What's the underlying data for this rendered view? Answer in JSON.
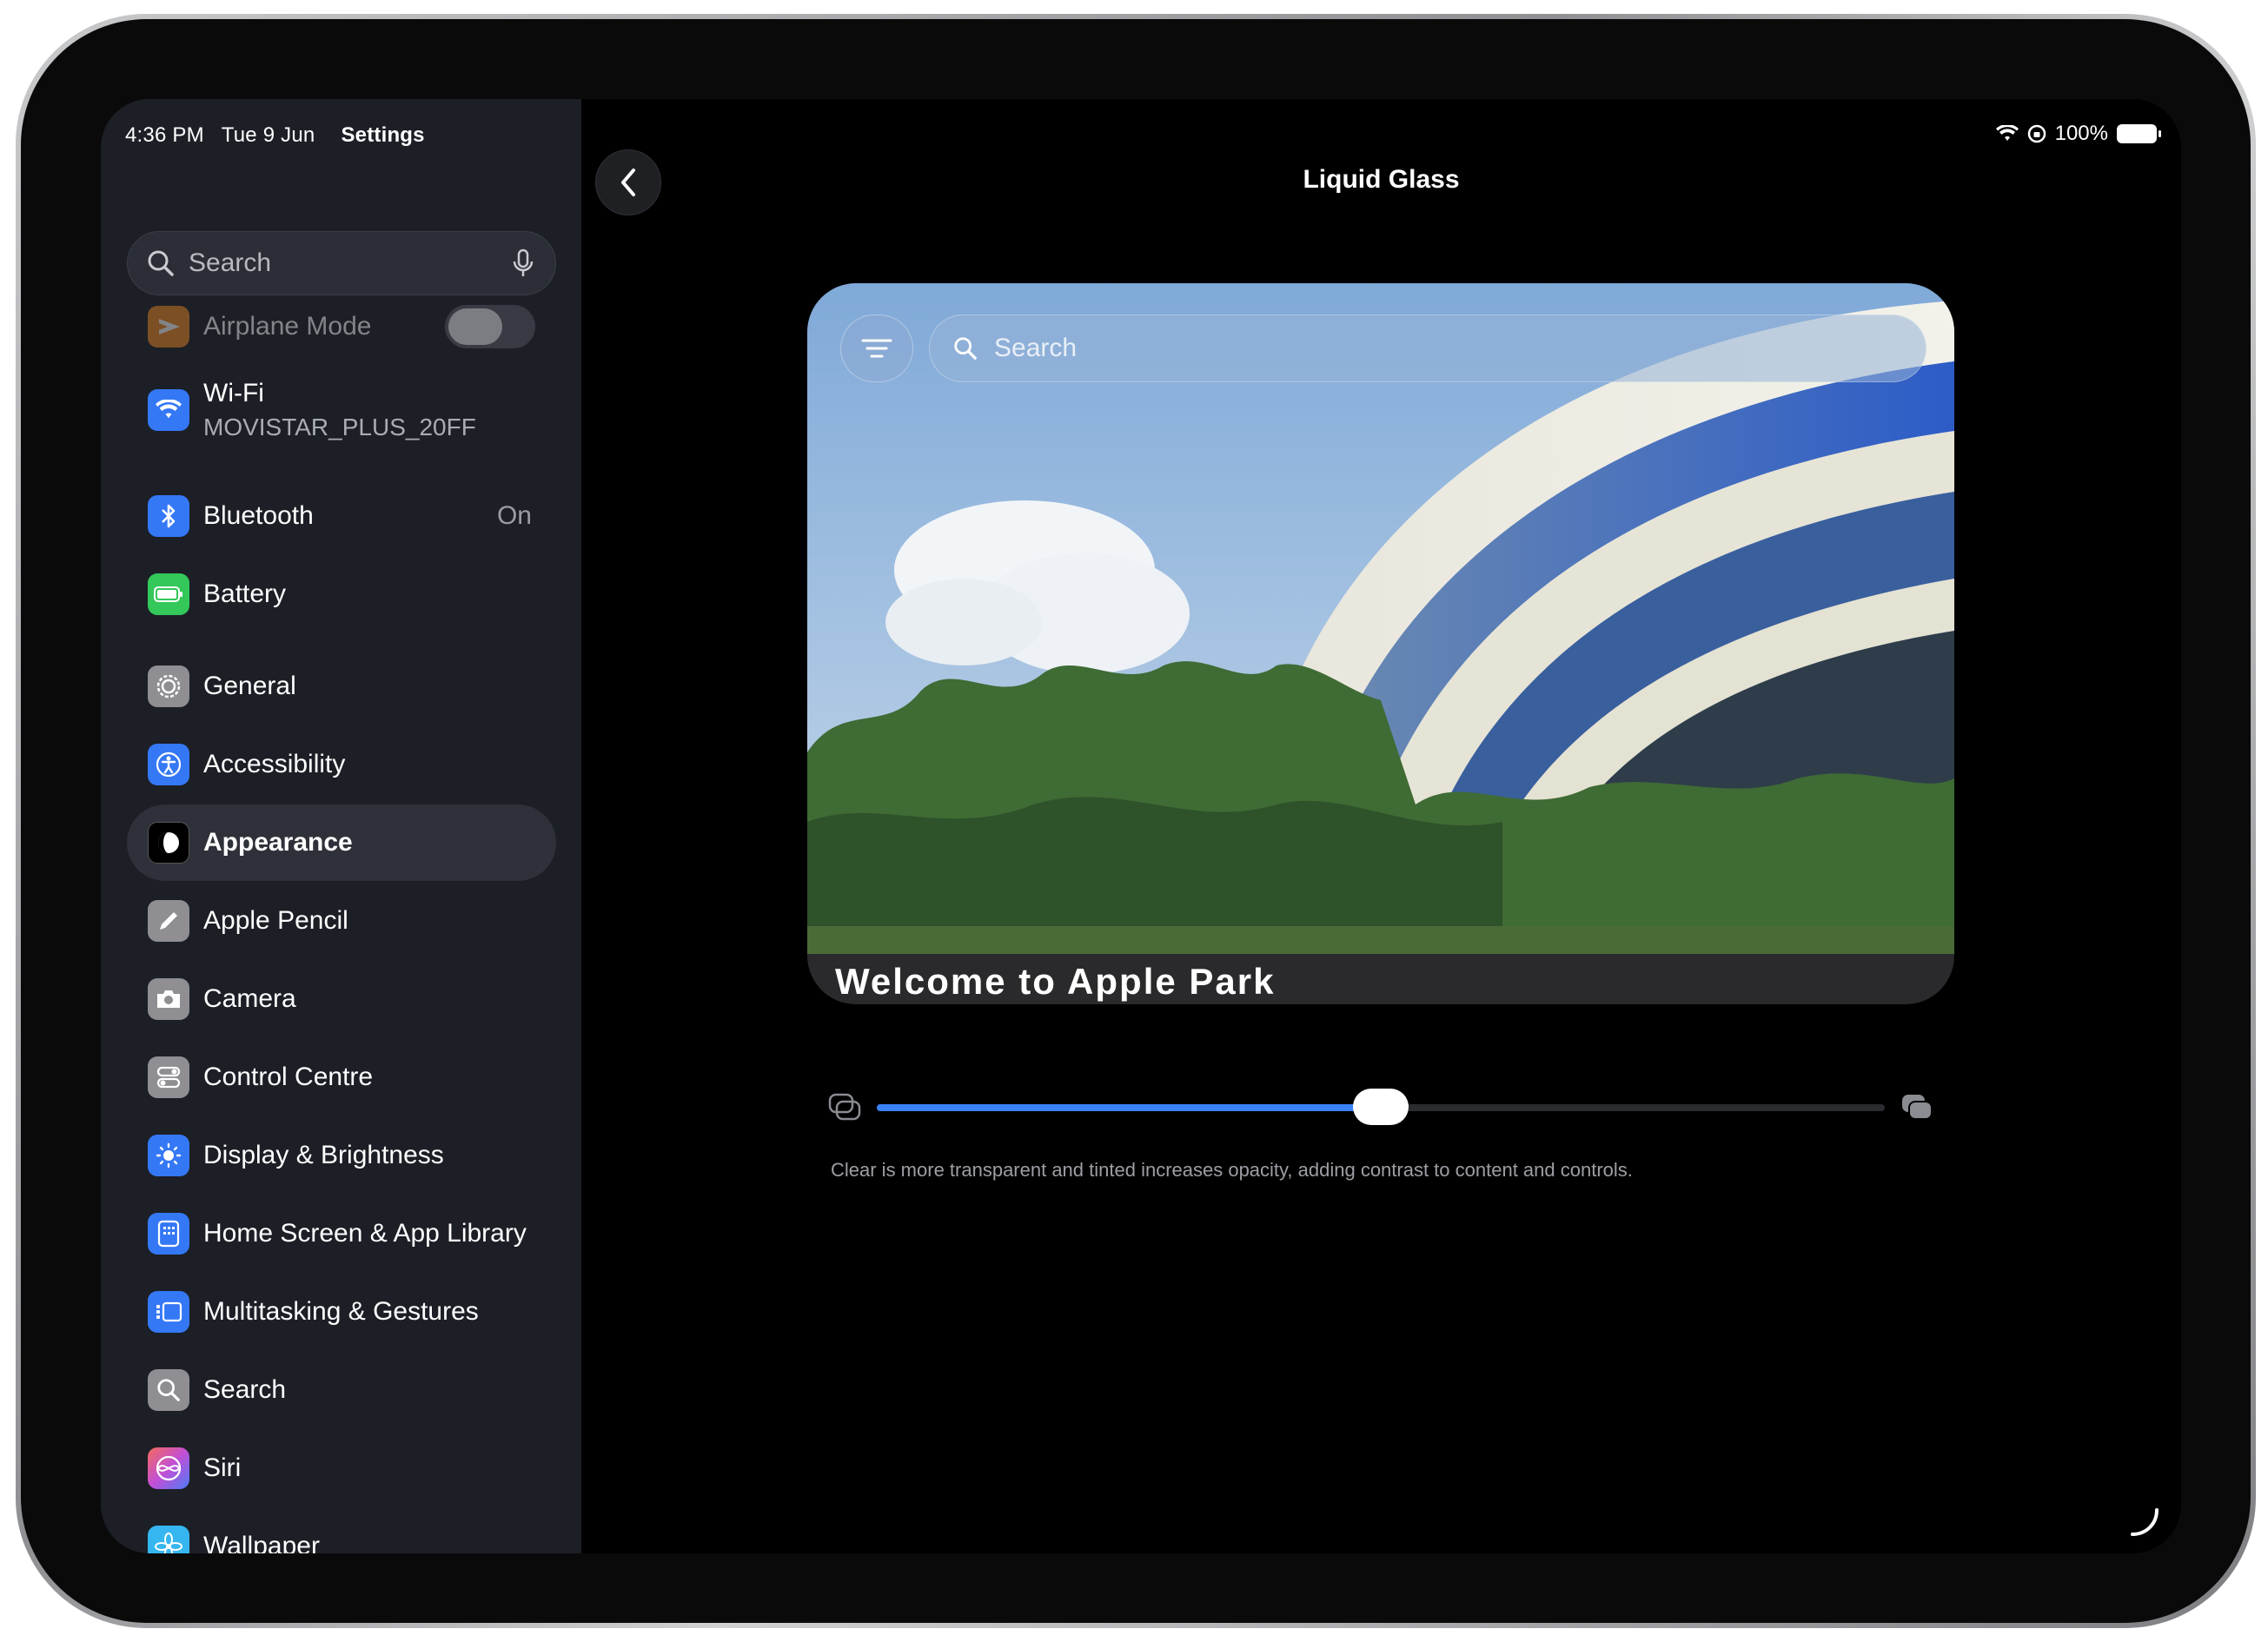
{
  "status_bar": {
    "time": "4:36 PM",
    "date": "Tue 9 Jun",
    "app": "Settings",
    "battery": "100%"
  },
  "sidebar": {
    "search_placeholder": "Search",
    "items": [
      {
        "label": "Airplane Mode",
        "icon": "airplane-icon",
        "color": "#f08a24"
      },
      {
        "label": "Wi-Fi",
        "sub": "MOVISTAR_PLUS_20FF",
        "icon": "wifi-icon",
        "color": "#3478f6"
      },
      {
        "label": "Bluetooth",
        "value": "On",
        "icon": "bluetooth-icon",
        "color": "#3478f6"
      },
      {
        "label": "Battery",
        "icon": "battery-icon",
        "color": "#34c759"
      },
      {
        "label": "General",
        "icon": "gear-icon",
        "color": "#8e8e93"
      },
      {
        "label": "Accessibility",
        "icon": "accessibility-icon",
        "color": "#3478f6"
      },
      {
        "label": "Appearance",
        "icon": "appearance-icon",
        "color": "#000000"
      },
      {
        "label": "Apple Pencil",
        "icon": "pencil-icon",
        "color": "#8e8e93"
      },
      {
        "label": "Camera",
        "icon": "camera-icon",
        "color": "#8e8e93"
      },
      {
        "label": "Control Centre",
        "icon": "control-centre-icon",
        "color": "#8e8e93"
      },
      {
        "label": "Display & Brightness",
        "icon": "sun-icon",
        "color": "#3478f6"
      },
      {
        "label": "Home Screen & App Library",
        "icon": "home-screen-icon",
        "color": "#3478f6"
      },
      {
        "label": "Multitasking & Gestures",
        "icon": "multitasking-icon",
        "color": "#3478f6"
      },
      {
        "label": "Search",
        "icon": "search-icon",
        "color": "#8e8e93"
      },
      {
        "label": "Siri",
        "icon": "siri-icon",
        "color": "#c24fd6"
      },
      {
        "label": "Wallpaper",
        "icon": "flower-icon",
        "color": "#35b6f0"
      }
    ]
  },
  "detail": {
    "title": "Liquid Glass",
    "preview_search_placeholder": "Search",
    "preview_caption": "Welcome to Apple Park",
    "slider_value": 0.5,
    "description": "Clear is more transparent and tinted increases opacity, adding contrast to content and controls."
  }
}
